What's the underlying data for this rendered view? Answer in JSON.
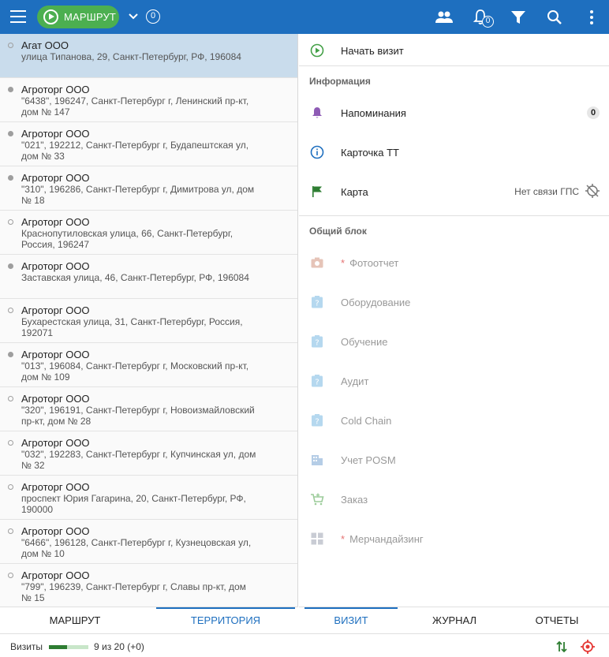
{
  "topbar": {
    "route_label": "МАРШРУТ",
    "route_count": "0",
    "bell_badge": "0",
    "icons": [
      "menu-icon",
      "play-icon",
      "chevron-down-icon",
      "people-icon",
      "bell-icon",
      "filter-icon",
      "search-icon",
      "more-vert-icon"
    ]
  },
  "list": [
    {
      "name": "Агат ООО",
      "addr": "улица Типанова, 29, Санкт-Петербург, РФ, 196084",
      "dot": "hollow",
      "selected": true
    },
    {
      "name": "Агроторг ООО",
      "addr": "\"6438\", 196247, Санкт-Петербург г, Ленинский пр-кт, дом № 147",
      "dot": "filled"
    },
    {
      "name": "Агроторг ООО",
      "addr": "\"021\", 192212, Санкт-Петербург г, Будапештская ул, дом № 33",
      "dot": "filled"
    },
    {
      "name": "Агроторг ООО",
      "addr": "\"310\", 196286, Санкт-Петербург г, Димитрова ул, дом № 18",
      "dot": "filled"
    },
    {
      "name": "Агроторг ООО",
      "addr": "Краснопутиловская улица, 66, Санкт-Петербург, Россия, 196247",
      "dot": "hollow"
    },
    {
      "name": "Агроторг ООО",
      "addr": "Заставская улица, 46, Санкт-Петербург, РФ, 196084",
      "dot": "filled"
    },
    {
      "name": "Агроторг ООО",
      "addr": "Бухарестская улица, 31, Санкт-Петербург, Россия, 192071",
      "dot": "hollow"
    },
    {
      "name": "Агроторг ООО",
      "addr": "\"013\", 196084, Санкт-Петербург г, Московский пр-кт, дом № 109",
      "dot": "filled"
    },
    {
      "name": "Агроторг ООО",
      "addr": "\"320\", 196191, Санкт-Петербург г, Новоизмайловский пр-кт, дом № 28",
      "dot": "hollow"
    },
    {
      "name": "Агроторг ООО",
      "addr": "\"032\", 192283, Санкт-Петербург г, Купчинская ул, дом № 32",
      "dot": "hollow"
    },
    {
      "name": "Агроторг ООО",
      "addr": "проспект Юрия Гагарина, 20, Санкт-Петербург, РФ, 190000",
      "dot": "hollow"
    },
    {
      "name": "Агроторг ООО",
      "addr": "\"6466\", 196128, Санкт-Петербург г, Кузнецовская ул, дом № 10",
      "dot": "hollow"
    },
    {
      "name": "Агроторг ООО",
      "addr": "\"799\", 196239, Санкт-Петербург г, Славы пр-кт, дом № 15",
      "dot": "hollow"
    }
  ],
  "panel": {
    "start_visit": "Начать визит",
    "info_header": "Информация",
    "reminders": "Напоминания",
    "reminders_count": "0",
    "card": "Карточка ТТ",
    "map": "Карта",
    "gps_status": "Нет связи ГПС",
    "common_header": "Общий блок",
    "common_items": [
      {
        "label": "Фотоотчет",
        "required": true,
        "icon": "camera-icon"
      },
      {
        "label": "Оборудование",
        "required": false,
        "icon": "question-box-icon"
      },
      {
        "label": "Обучение",
        "required": false,
        "icon": "question-box-icon"
      },
      {
        "label": "Аудит",
        "required": false,
        "icon": "question-box-icon"
      },
      {
        "label": "Cold Chain",
        "required": false,
        "icon": "question-box-icon"
      },
      {
        "label": "Учет POSM",
        "required": false,
        "icon": "building-icon"
      },
      {
        "label": "Заказ",
        "required": false,
        "icon": "cart-add-icon"
      },
      {
        "label": "Мерчандайзинг",
        "required": true,
        "icon": "grid-icon"
      }
    ],
    "required_mark": "*"
  },
  "tabs_left": [
    {
      "label": "МАРШРУТ",
      "active": false
    },
    {
      "label": "ТЕРРИТОРИЯ",
      "active": true
    }
  ],
  "tabs_right": [
    {
      "label": "ВИЗИТ",
      "active": true
    },
    {
      "label": "ЖУРНАЛ",
      "active": false
    },
    {
      "label": "ОТЧЕТЫ",
      "active": false
    }
  ],
  "status": {
    "visits_label": "Визиты",
    "visits_count": "9 из 20 (+0)",
    "progress": 0.45
  },
  "colors": {
    "topbar": "#1e6fbf",
    "route_button": "#4caf50",
    "selected_row": "#c9dcec",
    "accent": "#1e6fbf"
  }
}
